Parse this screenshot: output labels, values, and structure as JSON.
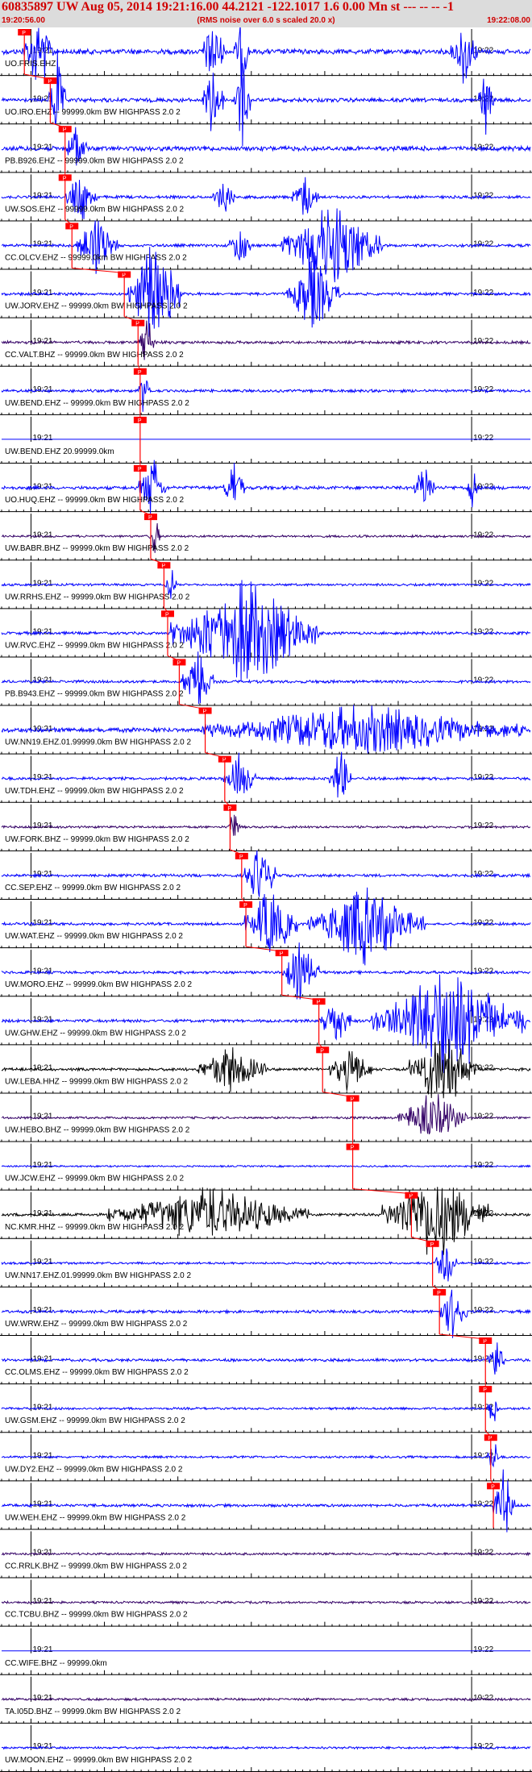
{
  "header": {
    "title": "60835897 UW Aug 05, 2014 19:21:16.00   44.2121 -122.1017  1.6 0.00 Mn st --- -- --  -1",
    "start_time": "19:20:56.00",
    "subtitle": "(RMS noise over 6.0 s scaled 20.0 x)",
    "end_time": "19:22:08.00"
  },
  "colors": {
    "trace_blue": "#0000ff",
    "trace_dark": "#330066",
    "trace_black": "#000000",
    "pick_red": "#ff0000",
    "header_bg": "#dcdcdc",
    "header_text": "#d00000"
  },
  "chart_data": {
    "type": "seismogram",
    "time_start": "19:20:56.00",
    "time_end": "19:22:08.00",
    "minute_marks": [
      "19:21",
      "19:22"
    ],
    "pick_label": "P",
    "traces": [
      {
        "label": "UO.FRIS.EHZ",
        "color": "blue",
        "pick": 0.043,
        "amp": 0.9,
        "bursts": [
          [
            0.04,
            0.1,
            2.5
          ],
          [
            0.38,
            0.42,
            2.5
          ],
          [
            0.44,
            0.47,
            2.2
          ],
          [
            0.85,
            0.9,
            2.0
          ]
        ]
      },
      {
        "label": "UO.IRO.EHZ -- 99999.0km BW  HIGHPASS  2.0  2",
        "color": "blue",
        "pick": 0.092,
        "amp": 0.7,
        "bursts": [
          [
            0.09,
            0.12,
            3.0
          ],
          [
            0.38,
            0.42,
            2.5
          ],
          [
            0.44,
            0.47,
            3.0
          ],
          [
            0.9,
            0.93,
            2.0
          ]
        ]
      },
      {
        "label": "PB.B926.EHZ -- 99999.0km BW  HIGHPASS  2.0  2",
        "color": "blue",
        "pick": 0.12,
        "amp": 0.8,
        "bursts": [
          [
            0.12,
            0.16,
            1.6
          ]
        ]
      },
      {
        "label": "UW.SOS.EHZ -- 99999.0km BW  HIGHPASS  2.0  2",
        "color": "blue",
        "pick": 0.12,
        "amp": 0.5,
        "bursts": [
          [
            0.12,
            0.18,
            1.6
          ],
          [
            0.4,
            0.44,
            1.4
          ],
          [
            0.55,
            0.6,
            1.3
          ]
        ]
      },
      {
        "label": "CC.OLCV.EHZ -- 99999.0km BW  HIGHPASS  2.0  2",
        "color": "blue",
        "pick": 0.133,
        "amp": 0.5,
        "bursts": [
          [
            0.14,
            0.22,
            2.0
          ],
          [
            0.43,
            0.47,
            1.4
          ],
          [
            0.53,
            0.72,
            2.6
          ]
        ]
      },
      {
        "label": "UW.JORV.EHZ -- 99999.0km BW  HIGHPASS  2.0  2",
        "color": "blue",
        "pick": 0.232,
        "amp": 0.5,
        "bursts": [
          [
            0.24,
            0.34,
            3.5
          ],
          [
            0.54,
            0.64,
            2.2
          ]
        ]
      },
      {
        "label": "CC.VALT.BHZ -- 99999.0km BW  HIGHPASS  2.0  2",
        "color": "dark",
        "pick": 0.258,
        "amp": 0.5,
        "bursts": [
          [
            0.26,
            0.29,
            1.8
          ]
        ]
      },
      {
        "label": "UW.BEND.EHZ -- 99999.0km BW  HIGHPASS  2.0  2",
        "color": "blue",
        "pick": 0.262,
        "amp": 0.5,
        "bursts": [
          [
            0.26,
            0.28,
            1.6
          ]
        ]
      },
      {
        "label": "UW.BEND.EHZ 20.99999.0km",
        "color": "blue",
        "pick": 0.262,
        "amp": 0.0,
        "bursts": []
      },
      {
        "label": "UO.HUQ.EHZ -- 99999.0km BW  HIGHPASS  2.0  2",
        "color": "blue",
        "pick": 0.262,
        "amp": 0.6,
        "bursts": [
          [
            0.26,
            0.31,
            2.0
          ],
          [
            0.42,
            0.46,
            1.6
          ],
          [
            0.78,
            0.82,
            1.5
          ],
          [
            0.88,
            0.9,
            1.4
          ]
        ]
      },
      {
        "label": "UW.BABR.BHZ -- 99999.0km BW  HIGHPASS  2.0  2",
        "color": "dark",
        "pick": 0.282,
        "amp": 0.4,
        "bursts": [
          [
            0.28,
            0.3,
            1.2
          ]
        ]
      },
      {
        "label": "UW.RRHS.EHZ -- 99999.0km BW  HIGHPASS  2.0  2",
        "color": "blue",
        "pick": 0.307,
        "amp": 0.4,
        "bursts": [
          [
            0.31,
            0.33,
            1.6
          ]
        ]
      },
      {
        "label": "UW.RVC.EHZ -- 99999.0km BW  HIGHPASS  2.0  2",
        "color": "blue",
        "pick": 0.314,
        "amp": 0.5,
        "bursts": [
          [
            0.32,
            0.6,
            3.2
          ]
        ]
      },
      {
        "label": "PB.B943.EHZ -- 99999.0km BW  HIGHPASS  2.0  2",
        "color": "blue",
        "pick": 0.336,
        "amp": 0.5,
        "bursts": [
          [
            0.34,
            0.4,
            2.0
          ]
        ]
      },
      {
        "label": "UW.NN19.EHZ.01.99999.0km BW  HIGHPASS  2.0  2",
        "color": "blue",
        "pick": 0.385,
        "amp": 0.8,
        "bursts": [
          [
            0.38,
            0.99,
            1.4
          ]
        ]
      },
      {
        "label": "UW.TDH.EHZ -- 99999.0km BW  HIGHPASS  2.0  2",
        "color": "blue",
        "pick": 0.422,
        "amp": 0.5,
        "bursts": [
          [
            0.42,
            0.48,
            1.5
          ],
          [
            0.62,
            0.66,
            1.8
          ]
        ]
      },
      {
        "label": "UW.FORK.BHZ -- 99999.0km BW  HIGHPASS  2.0  2",
        "color": "dark",
        "pick": 0.432,
        "amp": 0.4,
        "bursts": [
          [
            0.43,
            0.45,
            1.2
          ]
        ]
      },
      {
        "label": "CC.SEP.EHZ -- 99999.0km BW  HIGHPASS  2.0  2",
        "color": "blue",
        "pick": 0.454,
        "amp": 0.5,
        "bursts": [
          [
            0.46,
            0.52,
            2.0
          ]
        ]
      },
      {
        "label": "UW.WAT.EHZ -- 99999.0km BW  HIGHPASS  2.0  2",
        "color": "blue",
        "pick": 0.462,
        "amp": 0.5,
        "bursts": [
          [
            0.46,
            0.56,
            2.2
          ],
          [
            0.58,
            0.8,
            2.4
          ]
        ]
      },
      {
        "label": "UW.MORO.EHZ -- 99999.0km BW  HIGHPASS  2.0  2",
        "color": "blue",
        "pick": 0.53,
        "amp": 0.5,
        "bursts": [
          [
            0.53,
            0.6,
            1.8
          ]
        ]
      },
      {
        "label": "UW.GHW.EHZ -- 99999.0km BW  HIGHPASS  2.0  2",
        "color": "blue",
        "pick": 0.6,
        "amp": 0.5,
        "bursts": [
          [
            0.6,
            0.66,
            1.6
          ],
          [
            0.7,
            0.99,
            3.5
          ]
        ]
      },
      {
        "label": "UW.LEBA.HHZ -- 99999.0km BW  HIGHPASS  2.0  2",
        "color": "black",
        "pick": 0.607,
        "amp": 0.5,
        "bursts": [
          [
            0.37,
            0.5,
            1.4
          ],
          [
            0.62,
            0.7,
            1.4
          ],
          [
            0.77,
            0.9,
            2.5
          ]
        ]
      },
      {
        "label": "UW.HEBO.BHZ -- 99999.0km BW  HIGHPASS  2.0  2",
        "color": "dark",
        "pick": 0.664,
        "amp": 0.4,
        "bursts": [
          [
            0.75,
            0.88,
            1.6
          ]
        ]
      },
      {
        "label": "UW.JCW.EHZ -- 99999.0km BW  HIGHPASS  2.0  2",
        "color": "blue",
        "pick": 0.664,
        "amp": 0.3,
        "bursts": []
      },
      {
        "label": "NC.KMR.HHZ -- 99999.0km BW  HIGHPASS  2.0  2",
        "color": "black",
        "pick": 0.775,
        "amp": 0.5,
        "bursts": [
          [
            0.2,
            0.58,
            1.6
          ],
          [
            0.72,
            0.92,
            2.8
          ]
        ]
      },
      {
        "label": "UW.NN17.EHZ.01.99999.0km BW  HIGHPASS  2.0  2",
        "color": "blue",
        "pick": 0.815,
        "amp": 0.4,
        "bursts": [
          [
            0.82,
            0.86,
            1.6
          ]
        ]
      },
      {
        "label": "UW.WRW.EHZ -- 99999.0km BW  HIGHPASS  2.0  2",
        "color": "blue",
        "pick": 0.828,
        "amp": 0.5,
        "bursts": [
          [
            0.83,
            0.88,
            1.8
          ]
        ]
      },
      {
        "label": "CC.OLMS.EHZ -- 99999.0km BW  HIGHPASS  2.0  2",
        "color": "blue",
        "pick": 0.915,
        "amp": 0.5,
        "bursts": [
          [
            0.92,
            0.95,
            1.4
          ]
        ]
      },
      {
        "label": "UW.GSM.EHZ -- 99999.0km BW  HIGHPASS  2.0  2",
        "color": "blue",
        "pick": 0.915,
        "amp": 0.4,
        "bursts": [
          [
            0.92,
            0.94,
            1.2
          ]
        ]
      },
      {
        "label": "UW.DY2.EHZ -- 99999.0km BW  HIGHPASS  2.0  2",
        "color": "blue",
        "pick": 0.925,
        "amp": 0.4,
        "bursts": [
          [
            0.92,
            0.94,
            1.3
          ]
        ]
      },
      {
        "label": "UW.WEH.EHZ -- 99999.0km BW  HIGHPASS  2.0  2",
        "color": "blue",
        "pick": 0.93,
        "amp": 0.5,
        "bursts": [
          [
            0.93,
            0.97,
            2.2
          ]
        ]
      },
      {
        "label": "CC.RRLK.BHZ -- 99999.0km BW  HIGHPASS  2.0  2",
        "color": "dark",
        "pick": null,
        "amp": 0.4,
        "bursts": []
      },
      {
        "label": "CC.TCBU.BHZ -- 99999.0km BW  HIGHPASS  2.0  2",
        "color": "dark",
        "pick": null,
        "amp": 0.4,
        "bursts": []
      },
      {
        "label": "CC.WIFE.BHZ -- 99999.0km",
        "color": "blue",
        "pick": null,
        "amp": 0.0,
        "bursts": []
      },
      {
        "label": "TA.I05D.BHZ -- 99999.0km BW  HIGHPASS  2.0  2",
        "color": "dark",
        "pick": null,
        "amp": 0.4,
        "bursts": []
      },
      {
        "label": "UW.MOON.EHZ -- 99999.0km BW  HIGHPASS  2.0  2",
        "color": "blue",
        "pick": null,
        "amp": 0.4,
        "bursts": []
      }
    ]
  }
}
